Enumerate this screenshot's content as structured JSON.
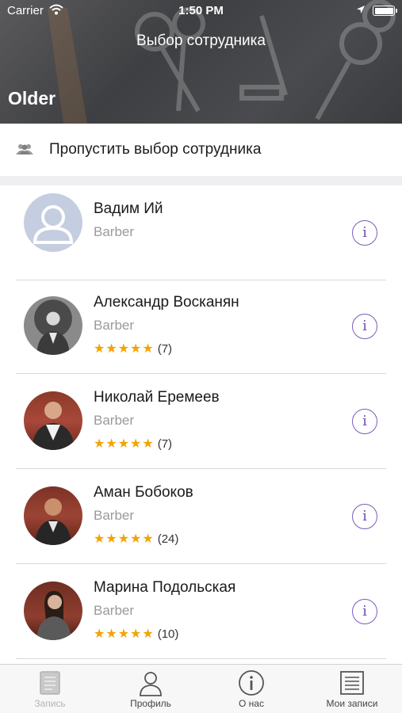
{
  "status_bar": {
    "carrier": "Carrier",
    "time": "1:50 PM"
  },
  "header": {
    "nav_title": "Выбор сотрудника",
    "large_title": "Older"
  },
  "skip": {
    "label": "Пропустить выбор сотрудника",
    "icon": "people-icon"
  },
  "staff": [
    {
      "name": "Вадим Ий",
      "role": "Barber",
      "stars": "",
      "reviews": "",
      "avatar": "placeholder"
    },
    {
      "name": "Александр Восканян",
      "role": "Barber",
      "stars": "★★★★★",
      "reviews": "(7)",
      "avatar": "photo"
    },
    {
      "name": "Николай Еремеев",
      "role": "Barber",
      "stars": "★★★★★",
      "reviews": "(7)",
      "avatar": "photo"
    },
    {
      "name": "Аман Бобоков",
      "role": "Barber",
      "stars": "★★★★★",
      "reviews": "(24)",
      "avatar": "photo"
    },
    {
      "name": "Марина Подольская",
      "role": "Barber",
      "stars": "★★★★★",
      "reviews": "(10)",
      "avatar": "photo"
    }
  ],
  "info_button": {
    "glyph": "i"
  },
  "tabs": [
    {
      "label": "Запись",
      "icon": "book-icon",
      "active": true
    },
    {
      "label": "Профиль",
      "icon": "person-icon",
      "active": false
    },
    {
      "label": "О нас",
      "icon": "info-icon",
      "active": false
    },
    {
      "label": "Мои записи",
      "icon": "list-icon",
      "active": false
    }
  ],
  "colors": {
    "accent": "#7c5bb8",
    "star": "#f4a300",
    "header_bg": "#45464a"
  }
}
